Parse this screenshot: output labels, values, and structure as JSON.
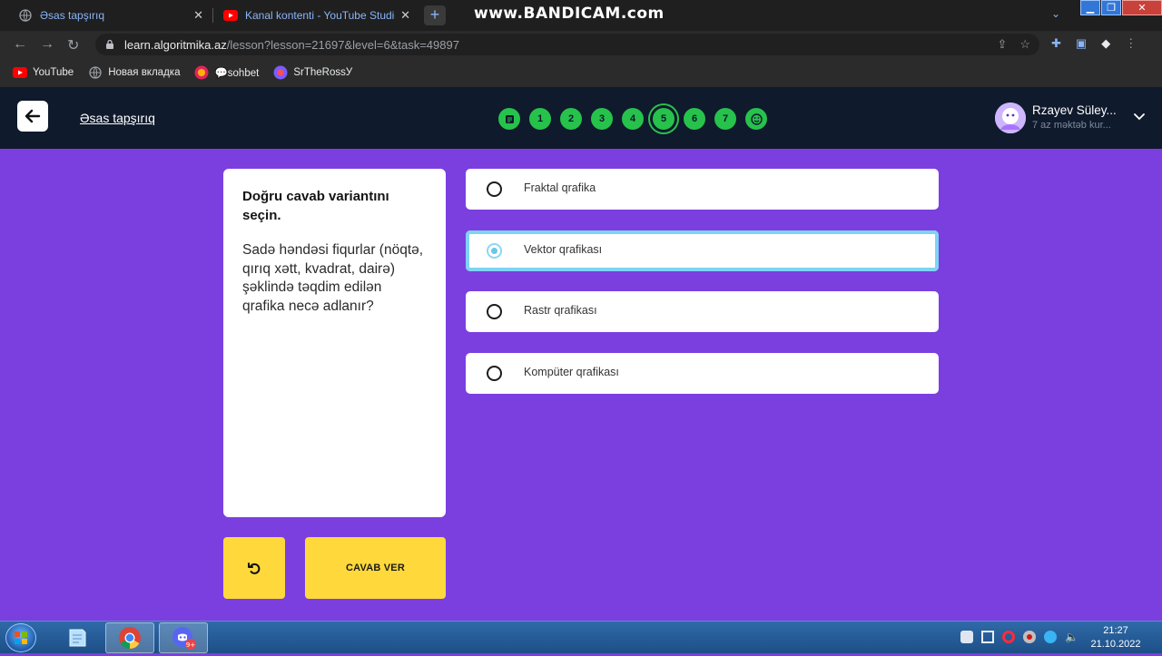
{
  "browser": {
    "tabs": [
      {
        "title": "Əsas tapşırıq",
        "active": true
      },
      {
        "title": "Kanal kontenti - YouTube Studio",
        "active": false
      }
    ],
    "watermark": "www.BANDICAM.com",
    "url_host": "learn.algoritmika.az",
    "url_path": "/lesson?lesson=21697&level=6&task=49897",
    "bookmarks": [
      "YouTube",
      "Новая вкладка",
      "💬sohbet",
      "SrTheRossУ"
    ]
  },
  "header": {
    "title": "Əsas tapşırıq",
    "steps": [
      "",
      "1",
      "2",
      "3",
      "4",
      "5",
      "6",
      "7",
      ""
    ],
    "current_step": "5",
    "user_name": "Rzayev Süley...",
    "user_sub": "7 az məktəb kur..."
  },
  "question": {
    "title": "Doğru cavab variantını seçin.",
    "text": "Sadə həndəsi fiqurlar (nöqtə, qırıq xətt, kvadrat, dairə) şəklində təqdim edilən qrafika necə adlanır?"
  },
  "options": [
    {
      "label": "Fraktal qrafika",
      "selected": false
    },
    {
      "label": "Vektor qrafikası",
      "selected": true
    },
    {
      "label": "Rastr qrafikası",
      "selected": false
    },
    {
      "label": "Kompüter qrafikası",
      "selected": false
    }
  ],
  "actions": {
    "submit_label": "CAVAB VER"
  },
  "taskbar": {
    "time": "21:27",
    "date": "21.10.2022",
    "discord_badge": "9+"
  },
  "colors": {
    "page_bg": "#7b3fe0",
    "header_bg": "#0f1a2c",
    "step_green": "#27c24c",
    "button_yellow": "#ffd93b",
    "selected_border": "#7fd3f5"
  }
}
